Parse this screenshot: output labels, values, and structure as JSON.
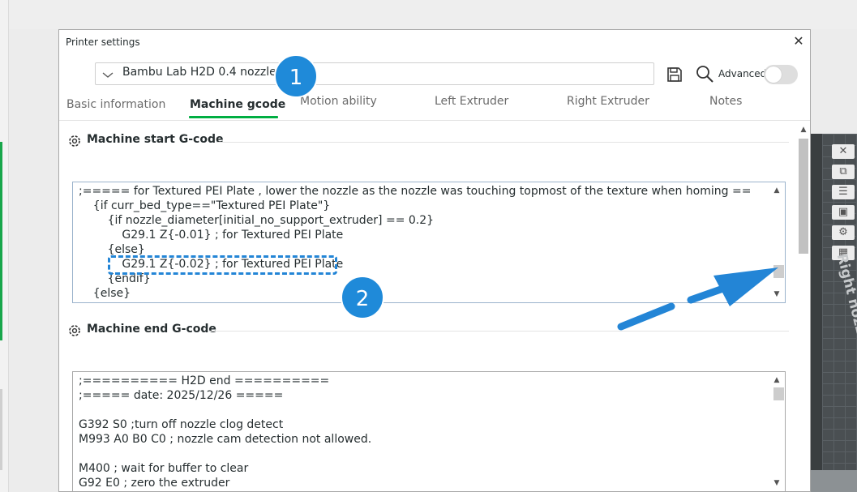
{
  "dialog": {
    "title": "Printer settings",
    "close_glyph": "✕"
  },
  "preset": {
    "value": "Bambu Lab H2D 0.4 nozzle"
  },
  "toolbar": {
    "advanced_label": "Advanced",
    "advanced_on": false
  },
  "tabs": [
    {
      "label": "Basic information",
      "active": false
    },
    {
      "label": "Machine gcode",
      "active": true
    },
    {
      "label": "Motion ability",
      "active": false
    },
    {
      "label": "Left Extruder",
      "active": false
    },
    {
      "label": "Right Extruder",
      "active": false
    },
    {
      "label": "Notes",
      "active": false
    }
  ],
  "start_gcode": {
    "title": "Machine start G-code",
    "lines": [
      ";===== for Textured PEI Plate , lower the nozzle as the nozzle was touching topmost of the texture when homing ==",
      "    {if curr_bed_type==\"Textured PEI Plate\"}",
      "        {if nozzle_diameter[initial_no_support_extruder] == 0.2}",
      "            G29.1 Z{-0.01} ; for Textured PEI Plate",
      "        {else}",
      "            G29.1 Z{-0.02} ; for Textured PEI Plate",
      "        {endif}",
      "    {else}"
    ]
  },
  "end_gcode": {
    "title": "Machine end G-code",
    "lines": [
      ";========== H2D end ==========",
      ";===== date: 2025/12/26 =====",
      "",
      "G392 S0 ;turn off nozzle clog detect",
      "M993 A0 B0 C0 ; nozzle cam detection not allowed.",
      "",
      "M400 ; wait for buffer to clear",
      "G92 E0 ; zero the extruder"
    ]
  },
  "background": {
    "bed_label": "Right nozzle only area"
  },
  "annotations": {
    "badge_1": "1",
    "badge_2": "2",
    "accent": "#1f8ad9"
  }
}
